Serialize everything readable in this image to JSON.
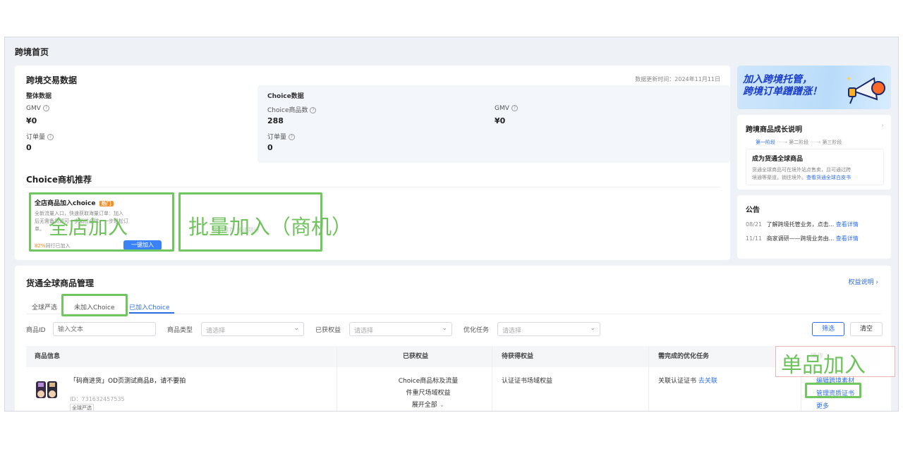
{
  "page": {
    "title": "跨境首页"
  },
  "trade": {
    "title": "跨境交易数据",
    "updated": "数据更新时间：2024年11月11日",
    "overall": {
      "title": "整体数据",
      "gmv_label": "GMV",
      "gmv_value": "¥0",
      "orders_label": "订单量",
      "orders_value": "0"
    },
    "choice": {
      "title": "Choice数据",
      "count_label": "Choice商品数",
      "count_value": "288",
      "orders_label": "订单量",
      "orders_value": "0",
      "gmv_label": "GMV",
      "gmv_value": "¥0"
    }
  },
  "opportunity": {
    "title": "Choice商机推荐",
    "card_title": "全店商品加入choice",
    "hot": "热门",
    "desc_line1": "全新流量入口，快速获取海量订单：加入",
    "desc_line2": "后无需备货即可一步销往全球，一步轻松订",
    "desc_line3": "单。",
    "rate": "82%",
    "rate_suffix": "同行已加入",
    "button": "一键加入",
    "card2_text": "商机推荐 敬请期待"
  },
  "annotations": {
    "store": "全店加入",
    "batch": "批量加入（商机）",
    "single": "单品加入"
  },
  "banner": {
    "line1": "加入跨境托管，",
    "line2": "跨境订单蹭蹭涨！"
  },
  "growth": {
    "title": "跨境商品成长说明",
    "steps": [
      "第一阶段",
      "第二阶段",
      "第三阶段"
    ],
    "heading": "成为货通全球商品",
    "desc": "货通全球商品可在境外站点售卖，且可通过跨",
    "desc2": "境通等渠道，销往境外。",
    "link": "查看货通全球白皮书"
  },
  "notice": {
    "title": "公告",
    "items": [
      {
        "date": "08/21",
        "text": "了解跨境托管业务，点击...",
        "link": "查看详情"
      },
      {
        "date": "11/11",
        "text": "商家调研——跨境业务由...",
        "link": "查看详情"
      }
    ]
  },
  "goods": {
    "title": "货通全球商品管理",
    "rights_link": "权益说明",
    "tabs": [
      "全球严选",
      "未加入Choice",
      "已加入Choice"
    ],
    "filters": {
      "id_label": "商品ID",
      "id_placeholder": "输入文本",
      "type_label": "商品类型",
      "type_placeholder": "请选择",
      "rights_label": "已获权益",
      "rights_placeholder": "请选择",
      "task_label": "优化任务",
      "task_placeholder": "请选择",
      "filter_btn": "筛选",
      "clear_btn": "清空"
    },
    "columns": [
      "商品信息",
      "已获权益",
      "待获得权益",
      "需完成的优化任务",
      "操作"
    ],
    "row": {
      "name": "「码商进货」OD页测试商品B，请不要拍",
      "id": "ID：731632457535",
      "tag": "全球严选",
      "rights": [
        "Choice商品标及流量",
        "件重尺场域权益"
      ],
      "expand": "展开全部",
      "pending": "认证证书场域权益",
      "task": "关联认证证书",
      "task_link": "去关联",
      "actions": [
        "编辑跨境素材",
        "管理资质证书",
        "更多"
      ]
    }
  }
}
